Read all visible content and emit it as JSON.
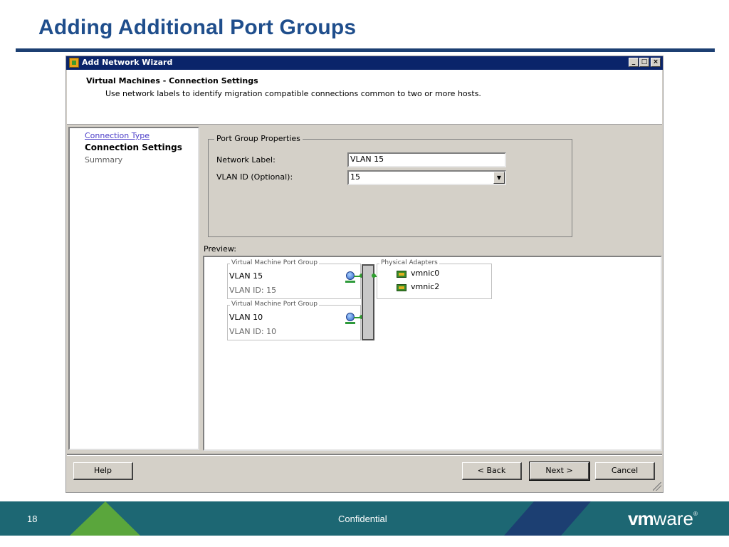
{
  "slide": {
    "title": "Adding Additional Port Groups",
    "page_number": "18",
    "footer_text": "Confidential",
    "brand": {
      "bold": "vm",
      "rest": "ware",
      "mark": "®"
    },
    "colors": {
      "title": "#1f4e8c",
      "footer": "#1d6773",
      "accent_green": "#5aa63c",
      "accent_navy": "#1c3f72"
    }
  },
  "window": {
    "title": "Add Network Wizard",
    "controls": {
      "minimize": "_",
      "maximize": "□",
      "close": "×"
    }
  },
  "header": {
    "title": "Virtual Machines - Connection Settings",
    "description": "Use network labels to identify migration compatible connections common to two or more hosts."
  },
  "steps": [
    {
      "label": "Connection Type",
      "state": "visited"
    },
    {
      "label": "Connection Settings",
      "state": "current"
    },
    {
      "label": "Summary",
      "state": "upcoming"
    }
  ],
  "port_group_properties": {
    "legend": "Port Group Properties",
    "network_label": {
      "label": "Network Label:",
      "value": "VLAN 15"
    },
    "vlan_id": {
      "label": "VLAN ID (Optional):",
      "value": "15"
    }
  },
  "preview": {
    "label": "Preview:",
    "port_groups": [
      {
        "legend": "Virtual Machine Port Group",
        "name": "VLAN 15",
        "vlan": "VLAN ID: 15"
      },
      {
        "legend": "Virtual Machine Port Group",
        "name": "VLAN 10",
        "vlan": "VLAN ID: 10"
      }
    ],
    "physical_adapters": {
      "legend": "Physical Adapters",
      "nics": [
        "vmnic0",
        "vmnic2"
      ]
    }
  },
  "buttons": {
    "help": "Help",
    "back": "< Back",
    "next": "Next >",
    "cancel": "Cancel"
  },
  "icons": {
    "app": "wizard-icon",
    "vm": "virtual-machine-icon",
    "nic": "network-adapter-icon"
  }
}
